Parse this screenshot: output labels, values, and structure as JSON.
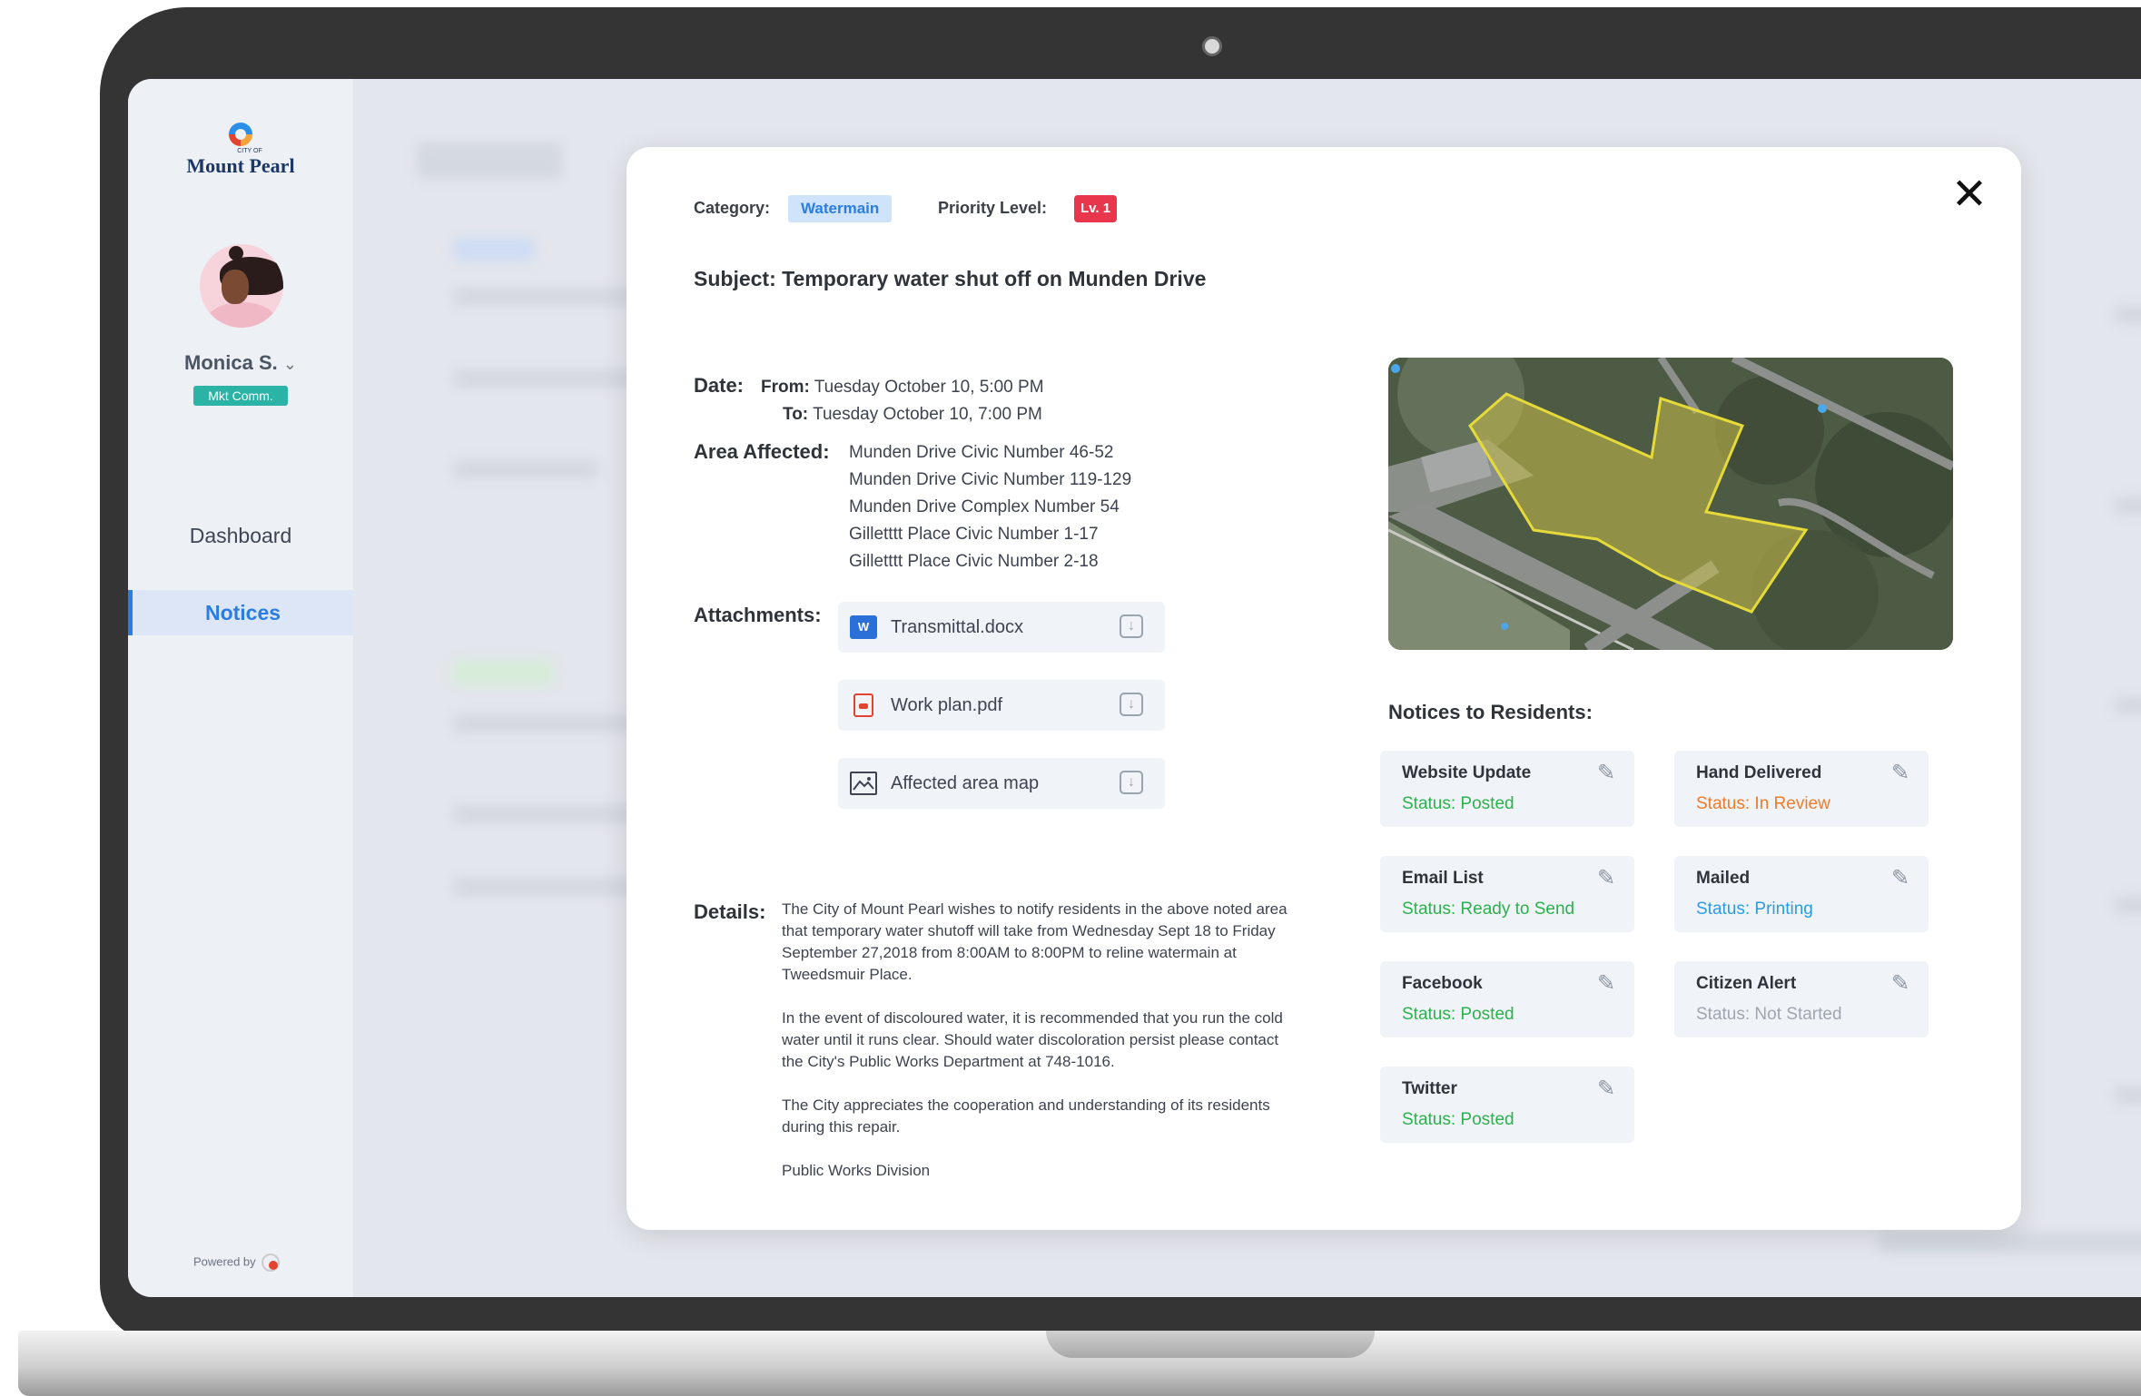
{
  "sidebar": {
    "logo_small": "CITY OF",
    "logo": "Mount Pearl",
    "user_name": "Monica S.",
    "user_role": "Mkt Comm.",
    "nav": [
      "Dashboard",
      "Notices"
    ],
    "powered_by": "Powered by"
  },
  "modal": {
    "category_label": "Category:",
    "category": "Watermain",
    "priority_label": "Priority Level:",
    "priority": "Lv. 1",
    "subject": "Subject: Temporary water shut off on Munden Drive",
    "date_label": "Date:",
    "from_label": "From:",
    "from": "Tuesday October 10, 5:00 PM",
    "to_label": "To:",
    "to": "Tuesday October 10, 7:00 PM",
    "area_label": "Area Affected:",
    "areas": [
      "Munden Drive Civic Number 46-52",
      "Munden Drive Civic Number 119-129",
      "Munden Drive Complex Number 54",
      "Gilletttt Place Civic Number 1-17",
      "Gilletttt Place Civic Number 2-18"
    ],
    "attachments_label": "Attachments:",
    "attachments": [
      {
        "name": "Transmittal.docx",
        "icon": "word-doc-icon"
      },
      {
        "name": "Work plan.pdf",
        "icon": "pdf-icon"
      },
      {
        "name": "Affected area map",
        "icon": "image-icon"
      }
    ],
    "details_label": "Details:",
    "details": [
      "The City of Mount Pearl wishes to notify residents in the above noted area that temporary water shutoff will take from Wednesday Sept 18 to Friday September 27,2018 from 8:00AM to 8:00PM to reline watermain at Tweedsmuir Place.",
      "In the event of discoloured water, it is recommended that you run the cold water until it runs clear. Should water discoloration persist please contact the City's Public Works Department at 748-1016.",
      "The City appreciates the cooperation and understanding of its residents during this repair.",
      "Public Works Division"
    ],
    "notices_title": "Notices to Residents:",
    "notices": [
      {
        "title": "Website Update",
        "status": "Status: Posted",
        "color": "#2bb24c"
      },
      {
        "title": "Hand Delivered",
        "status": "Status: In Review",
        "color": "#f07b2b"
      },
      {
        "title": "Email List",
        "status": "Status: Ready to Send",
        "color": "#2bb24c"
      },
      {
        "title": "Mailed",
        "status": "Status: Printing",
        "color": "#2a9de1"
      },
      {
        "title": "Facebook",
        "status": "Status: Posted",
        "color": "#2bb24c"
      },
      {
        "title": "Citizen Alert",
        "status": "Status: Not Started",
        "color": "#a0a6b0"
      },
      {
        "title": "Twitter",
        "status": "Status: Posted",
        "color": "#2bb24c"
      }
    ]
  },
  "colors": {
    "accent": "#2a7de1",
    "priority": "#e8364c",
    "role_badge": "#2bb3a5"
  }
}
